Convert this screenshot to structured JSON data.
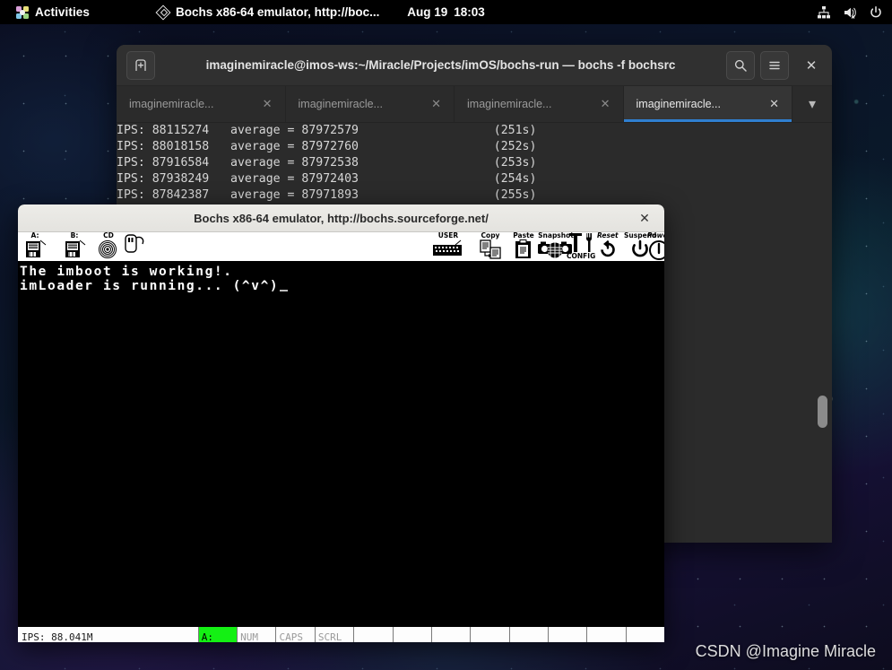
{
  "topbar": {
    "activities": "Activities",
    "app_menu": "Bochs x86-64 emulator, http://boc...",
    "clock_date": "Aug 19",
    "clock_time": "18:03",
    "icons": [
      "network-icon",
      "volume-muted-icon",
      "power-icon"
    ]
  },
  "terminal": {
    "title": "imaginemiracle@imos-ws:~/Miracle/Projects/imOS/bochs-run — bochs -f bochsrc",
    "newtab_label": "+",
    "search_label": "search-icon",
    "menu_label": "menu-icon",
    "close_label": "✕",
    "dropdown_label": "▾",
    "tabs": [
      {
        "label": "imaginemiracle...",
        "close": "✕",
        "active": false
      },
      {
        "label": "imaginemiracle...",
        "close": "✕",
        "active": false
      },
      {
        "label": "imaginemiracle...",
        "close": "✕",
        "active": false
      },
      {
        "label": "imaginemiracle...",
        "close": "✕",
        "active": true
      }
    ],
    "lines": [
      "IPS: 88115274   average = 87972579                   (251s)",
      "IPS: 88018158   average = 87972760                   (252s)",
      "IPS: 87916584   average = 87972538                   (253s)",
      "IPS: 87938249   average = 87972403                   (254s)",
      "IPS: 87842387   average = 87971893                   (255s)"
    ]
  },
  "bochs": {
    "title": "Bochs x86-64 emulator, http://bochs.sourceforge.net/",
    "close_label": "✕",
    "toolbar_left": [
      {
        "caption": "A:",
        "icon": "floppy-a-icon"
      },
      {
        "caption": "B:",
        "icon": "floppy-b-icon"
      },
      {
        "caption": "CD",
        "icon": "cdrom-icon"
      },
      {
        "caption": "",
        "icon": "mouse-icon"
      }
    ],
    "toolbar_right": [
      {
        "caption": "USER",
        "icon": "keyboard-icon"
      },
      {
        "caption": "Copy",
        "icon": "copy-icon"
      },
      {
        "caption": "Paste",
        "icon": "paste-icon"
      },
      {
        "caption": "Snapshot",
        "icon": "camera-icon"
      },
      {
        "caption": "CONFIG",
        "icon": "wrench-icon"
      },
      {
        "caption": "Reset",
        "icon": "reset-icon"
      },
      {
        "caption": "Suspend",
        "icon": "suspend-icon"
      },
      {
        "caption": "Power",
        "icon": "power-icon"
      }
    ],
    "screen_lines": [
      "The imboot is working!.",
      "",
      "imLoader is running... (^v^)"
    ],
    "status": {
      "ips": "IPS: 88.041M",
      "cells": [
        {
          "label": "A:",
          "active": true
        },
        {
          "label": "NUM",
          "active": false
        },
        {
          "label": "CAPS",
          "active": false
        },
        {
          "label": "SCRL",
          "active": false
        },
        {
          "label": "",
          "active": false
        },
        {
          "label": "",
          "active": false
        },
        {
          "label": "",
          "active": false
        },
        {
          "label": "",
          "active": false
        },
        {
          "label": "",
          "active": false
        },
        {
          "label": "",
          "active": false
        },
        {
          "label": "",
          "active": false
        },
        {
          "label": "",
          "active": false
        }
      ]
    }
  },
  "watermark": "CSDN @Imagine Miracle",
  "colors": {
    "accent_tab": "#2f7fd0",
    "status_active": "#14f014",
    "topbar_bg": "#000000",
    "terminal_bg": "#2b2b2b",
    "bochs_titlebar": "#ebeae6"
  }
}
